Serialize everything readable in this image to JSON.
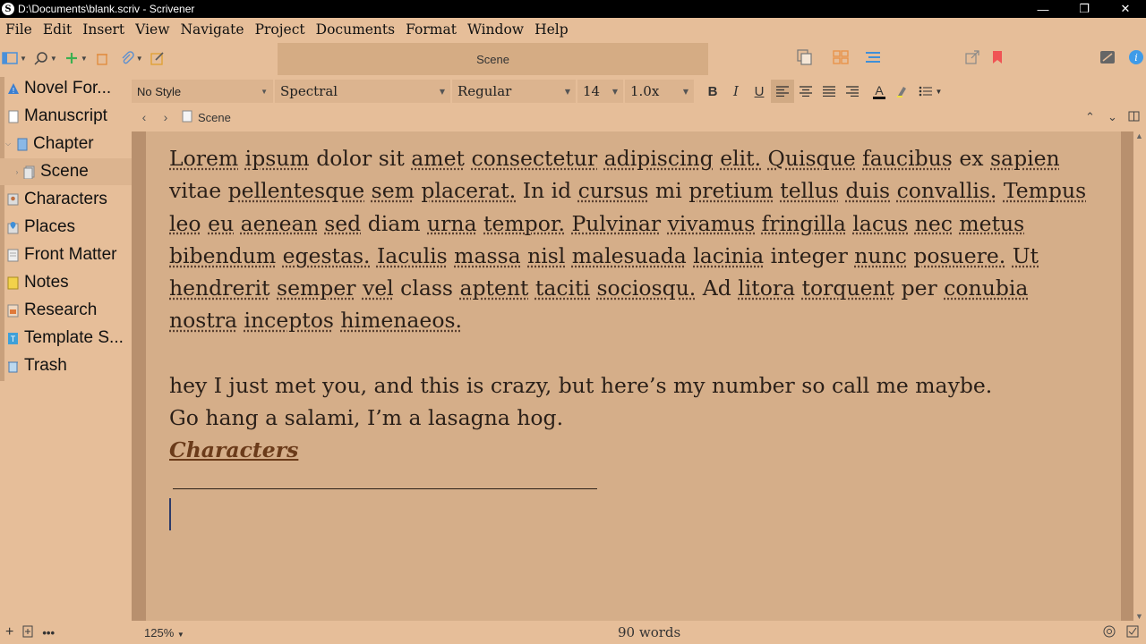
{
  "window": {
    "title": "D:\\Documents\\blank.scriv - Scrivener",
    "minimize": "—",
    "restore": "❐",
    "close": "✕",
    "logo": "S"
  },
  "menu": [
    "File",
    "Edit",
    "Insert",
    "View",
    "Navigate",
    "Project",
    "Documents",
    "Format",
    "Window",
    "Help"
  ],
  "toolbar": {
    "document_title": "Scene",
    "icons": [
      "binder-toggle-icon",
      "search-icon",
      "add-icon",
      "trash-icon",
      "attachment-icon",
      "compose-icon",
      "copy-icon",
      "corkboard-icon",
      "outline-icon",
      "share-icon",
      "bookmark-icon",
      "inspector-icon",
      "info-icon"
    ]
  },
  "binder": {
    "items": [
      {
        "label": "Novel For...",
        "icon": "novel-format-icon",
        "color": "#3b7fd0"
      },
      {
        "label": "Manuscript",
        "icon": "manuscript-icon",
        "color": "#ffffff"
      },
      {
        "label": "Chapter",
        "icon": "folder-icon",
        "color": "#8ab8e6"
      },
      {
        "label": "Scene",
        "icon": "document-icon",
        "color": "#d0d0d0"
      },
      {
        "label": "Characters",
        "icon": "characters-icon",
        "color": "#c8c8c8"
      },
      {
        "label": "Places",
        "icon": "places-icon",
        "color": "#7bb0d8"
      },
      {
        "label": "Front Matter",
        "icon": "front-matter-icon",
        "color": "#e6e6e6"
      },
      {
        "label": "Notes",
        "icon": "notes-icon",
        "color": "#f2d24a"
      },
      {
        "label": "Research",
        "icon": "research-icon",
        "color": "#e8a070"
      },
      {
        "label": "Template S...",
        "icon": "template-icon",
        "color": "#3fa0d8"
      },
      {
        "label": "Trash",
        "icon": "trash-icon",
        "color": "#7bb0d8"
      }
    ]
  },
  "format": {
    "style": "No Style",
    "font": "Spectral",
    "weight": "Regular",
    "size": "14",
    "spacing": "1.0x",
    "bold": "B",
    "italic": "I",
    "underline": "U",
    "text_color": "A"
  },
  "header": {
    "doc_label": "Scene"
  },
  "editor": {
    "paragraph_words": [
      [
        "Lorem",
        true
      ],
      [
        "ipsum",
        true
      ],
      [
        "dolor",
        false
      ],
      [
        "sit",
        false
      ],
      [
        "amet",
        true
      ],
      [
        "consectetur",
        true
      ],
      [
        "adipiscing",
        true
      ],
      [
        "elit.",
        true
      ],
      [
        "Quisque",
        true
      ],
      [
        "faucibus",
        true
      ],
      [
        "ex",
        false
      ],
      [
        "sapien",
        true
      ],
      [
        "vitae",
        false
      ],
      [
        "pellentesque",
        true
      ],
      [
        "sem",
        true
      ],
      [
        "placerat.",
        true
      ],
      [
        "In",
        false
      ],
      [
        "id",
        false
      ],
      [
        "cursus",
        true
      ],
      [
        "mi",
        false
      ],
      [
        "pretium",
        true
      ],
      [
        "tellus",
        true
      ],
      [
        "duis",
        true
      ],
      [
        "convallis.",
        true
      ],
      [
        "Tempus",
        true
      ],
      [
        "leo",
        true
      ],
      [
        "eu",
        true
      ],
      [
        "aenean",
        true
      ],
      [
        "sed",
        true
      ],
      [
        "diam",
        false
      ],
      [
        "urna",
        true
      ],
      [
        "tempor.",
        true
      ],
      [
        "Pulvinar",
        true
      ],
      [
        "vivamus",
        true
      ],
      [
        "fringilla",
        true
      ],
      [
        "lacus",
        true
      ],
      [
        "nec",
        true
      ],
      [
        "metus",
        true
      ],
      [
        "bibendum",
        true
      ],
      [
        "egestas.",
        true
      ],
      [
        "Iaculis",
        true
      ],
      [
        "massa",
        true
      ],
      [
        "nisl",
        true
      ],
      [
        "malesuada",
        true
      ],
      [
        "lacinia",
        true
      ],
      [
        "integer",
        false
      ],
      [
        "nunc",
        true
      ],
      [
        "posuere.",
        true
      ],
      [
        "Ut",
        true
      ],
      [
        "hendrerit",
        true
      ],
      [
        "semper",
        true
      ],
      [
        "vel",
        true
      ],
      [
        "class",
        false
      ],
      [
        "aptent",
        true
      ],
      [
        "taciti",
        true
      ],
      [
        "sociosqu.",
        true
      ],
      [
        "Ad",
        false
      ],
      [
        "litora",
        true
      ],
      [
        "torquent",
        true
      ],
      [
        "per",
        false
      ],
      [
        "conubia",
        true
      ],
      [
        "nostra",
        true
      ],
      [
        "inceptos",
        true
      ],
      [
        "himenaeos.",
        true
      ]
    ],
    "line2": "hey I just met you, and this is crazy, but here’s my number so call me maybe.",
    "line3": "Go hang a salami, I’m a lasagna hog.",
    "heading_link": "Characters"
  },
  "footer": {
    "zoom": "125%",
    "word_count": "90 words"
  }
}
